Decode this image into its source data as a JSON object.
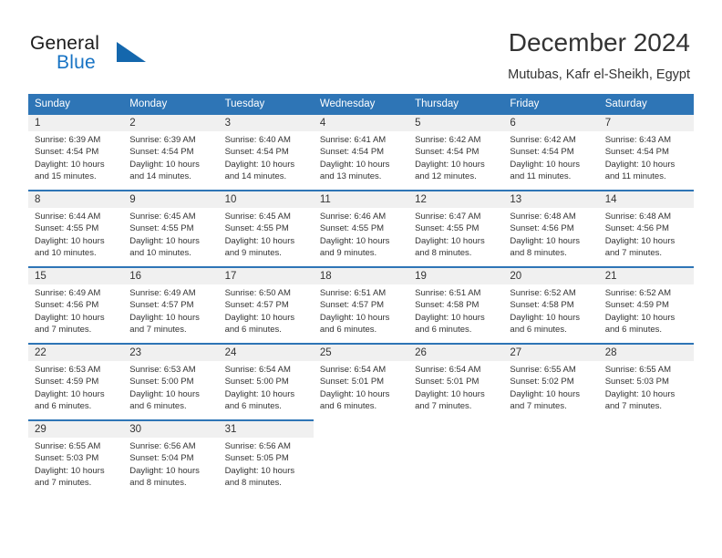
{
  "brand": {
    "name_part1": "General",
    "name_part2": "Blue",
    "triangle_icon": "triangle-logo-icon",
    "accent_color": "#1467ad"
  },
  "header": {
    "month_title": "December 2024",
    "location": "Mutubas, Kafr el-Sheikh, Egypt"
  },
  "theme": {
    "header_blue": "#2e75b6",
    "day_strip_gray": "#f0f0f0",
    "text_color": "#333333"
  },
  "weekdays": [
    "Sunday",
    "Monday",
    "Tuesday",
    "Wednesday",
    "Thursday",
    "Friday",
    "Saturday"
  ],
  "weeks": [
    [
      {
        "day": "1",
        "sunrise": "Sunrise: 6:39 AM",
        "sunset": "Sunset: 4:54 PM",
        "daylight1": "Daylight: 10 hours",
        "daylight2": "and 15 minutes."
      },
      {
        "day": "2",
        "sunrise": "Sunrise: 6:39 AM",
        "sunset": "Sunset: 4:54 PM",
        "daylight1": "Daylight: 10 hours",
        "daylight2": "and 14 minutes."
      },
      {
        "day": "3",
        "sunrise": "Sunrise: 6:40 AM",
        "sunset": "Sunset: 4:54 PM",
        "daylight1": "Daylight: 10 hours",
        "daylight2": "and 14 minutes."
      },
      {
        "day": "4",
        "sunrise": "Sunrise: 6:41 AM",
        "sunset": "Sunset: 4:54 PM",
        "daylight1": "Daylight: 10 hours",
        "daylight2": "and 13 minutes."
      },
      {
        "day": "5",
        "sunrise": "Sunrise: 6:42 AM",
        "sunset": "Sunset: 4:54 PM",
        "daylight1": "Daylight: 10 hours",
        "daylight2": "and 12 minutes."
      },
      {
        "day": "6",
        "sunrise": "Sunrise: 6:42 AM",
        "sunset": "Sunset: 4:54 PM",
        "daylight1": "Daylight: 10 hours",
        "daylight2": "and 11 minutes."
      },
      {
        "day": "7",
        "sunrise": "Sunrise: 6:43 AM",
        "sunset": "Sunset: 4:54 PM",
        "daylight1": "Daylight: 10 hours",
        "daylight2": "and 11 minutes."
      }
    ],
    [
      {
        "day": "8",
        "sunrise": "Sunrise: 6:44 AM",
        "sunset": "Sunset: 4:55 PM",
        "daylight1": "Daylight: 10 hours",
        "daylight2": "and 10 minutes."
      },
      {
        "day": "9",
        "sunrise": "Sunrise: 6:45 AM",
        "sunset": "Sunset: 4:55 PM",
        "daylight1": "Daylight: 10 hours",
        "daylight2": "and 10 minutes."
      },
      {
        "day": "10",
        "sunrise": "Sunrise: 6:45 AM",
        "sunset": "Sunset: 4:55 PM",
        "daylight1": "Daylight: 10 hours",
        "daylight2": "and 9 minutes."
      },
      {
        "day": "11",
        "sunrise": "Sunrise: 6:46 AM",
        "sunset": "Sunset: 4:55 PM",
        "daylight1": "Daylight: 10 hours",
        "daylight2": "and 9 minutes."
      },
      {
        "day": "12",
        "sunrise": "Sunrise: 6:47 AM",
        "sunset": "Sunset: 4:55 PM",
        "daylight1": "Daylight: 10 hours",
        "daylight2": "and 8 minutes."
      },
      {
        "day": "13",
        "sunrise": "Sunrise: 6:48 AM",
        "sunset": "Sunset: 4:56 PM",
        "daylight1": "Daylight: 10 hours",
        "daylight2": "and 8 minutes."
      },
      {
        "day": "14",
        "sunrise": "Sunrise: 6:48 AM",
        "sunset": "Sunset: 4:56 PM",
        "daylight1": "Daylight: 10 hours",
        "daylight2": "and 7 minutes."
      }
    ],
    [
      {
        "day": "15",
        "sunrise": "Sunrise: 6:49 AM",
        "sunset": "Sunset: 4:56 PM",
        "daylight1": "Daylight: 10 hours",
        "daylight2": "and 7 minutes."
      },
      {
        "day": "16",
        "sunrise": "Sunrise: 6:49 AM",
        "sunset": "Sunset: 4:57 PM",
        "daylight1": "Daylight: 10 hours",
        "daylight2": "and 7 minutes."
      },
      {
        "day": "17",
        "sunrise": "Sunrise: 6:50 AM",
        "sunset": "Sunset: 4:57 PM",
        "daylight1": "Daylight: 10 hours",
        "daylight2": "and 6 minutes."
      },
      {
        "day": "18",
        "sunrise": "Sunrise: 6:51 AM",
        "sunset": "Sunset: 4:57 PM",
        "daylight1": "Daylight: 10 hours",
        "daylight2": "and 6 minutes."
      },
      {
        "day": "19",
        "sunrise": "Sunrise: 6:51 AM",
        "sunset": "Sunset: 4:58 PM",
        "daylight1": "Daylight: 10 hours",
        "daylight2": "and 6 minutes."
      },
      {
        "day": "20",
        "sunrise": "Sunrise: 6:52 AM",
        "sunset": "Sunset: 4:58 PM",
        "daylight1": "Daylight: 10 hours",
        "daylight2": "and 6 minutes."
      },
      {
        "day": "21",
        "sunrise": "Sunrise: 6:52 AM",
        "sunset": "Sunset: 4:59 PM",
        "daylight1": "Daylight: 10 hours",
        "daylight2": "and 6 minutes."
      }
    ],
    [
      {
        "day": "22",
        "sunrise": "Sunrise: 6:53 AM",
        "sunset": "Sunset: 4:59 PM",
        "daylight1": "Daylight: 10 hours",
        "daylight2": "and 6 minutes."
      },
      {
        "day": "23",
        "sunrise": "Sunrise: 6:53 AM",
        "sunset": "Sunset: 5:00 PM",
        "daylight1": "Daylight: 10 hours",
        "daylight2": "and 6 minutes."
      },
      {
        "day": "24",
        "sunrise": "Sunrise: 6:54 AM",
        "sunset": "Sunset: 5:00 PM",
        "daylight1": "Daylight: 10 hours",
        "daylight2": "and 6 minutes."
      },
      {
        "day": "25",
        "sunrise": "Sunrise: 6:54 AM",
        "sunset": "Sunset: 5:01 PM",
        "daylight1": "Daylight: 10 hours",
        "daylight2": "and 6 minutes."
      },
      {
        "day": "26",
        "sunrise": "Sunrise: 6:54 AM",
        "sunset": "Sunset: 5:01 PM",
        "daylight1": "Daylight: 10 hours",
        "daylight2": "and 7 minutes."
      },
      {
        "day": "27",
        "sunrise": "Sunrise: 6:55 AM",
        "sunset": "Sunset: 5:02 PM",
        "daylight1": "Daylight: 10 hours",
        "daylight2": "and 7 minutes."
      },
      {
        "day": "28",
        "sunrise": "Sunrise: 6:55 AM",
        "sunset": "Sunset: 5:03 PM",
        "daylight1": "Daylight: 10 hours",
        "daylight2": "and 7 minutes."
      }
    ],
    [
      {
        "day": "29",
        "sunrise": "Sunrise: 6:55 AM",
        "sunset": "Sunset: 5:03 PM",
        "daylight1": "Daylight: 10 hours",
        "daylight2": "and 7 minutes."
      },
      {
        "day": "30",
        "sunrise": "Sunrise: 6:56 AM",
        "sunset": "Sunset: 5:04 PM",
        "daylight1": "Daylight: 10 hours",
        "daylight2": "and 8 minutes."
      },
      {
        "day": "31",
        "sunrise": "Sunrise: 6:56 AM",
        "sunset": "Sunset: 5:05 PM",
        "daylight1": "Daylight: 10 hours",
        "daylight2": "and 8 minutes."
      },
      null,
      null,
      null,
      null
    ]
  ]
}
